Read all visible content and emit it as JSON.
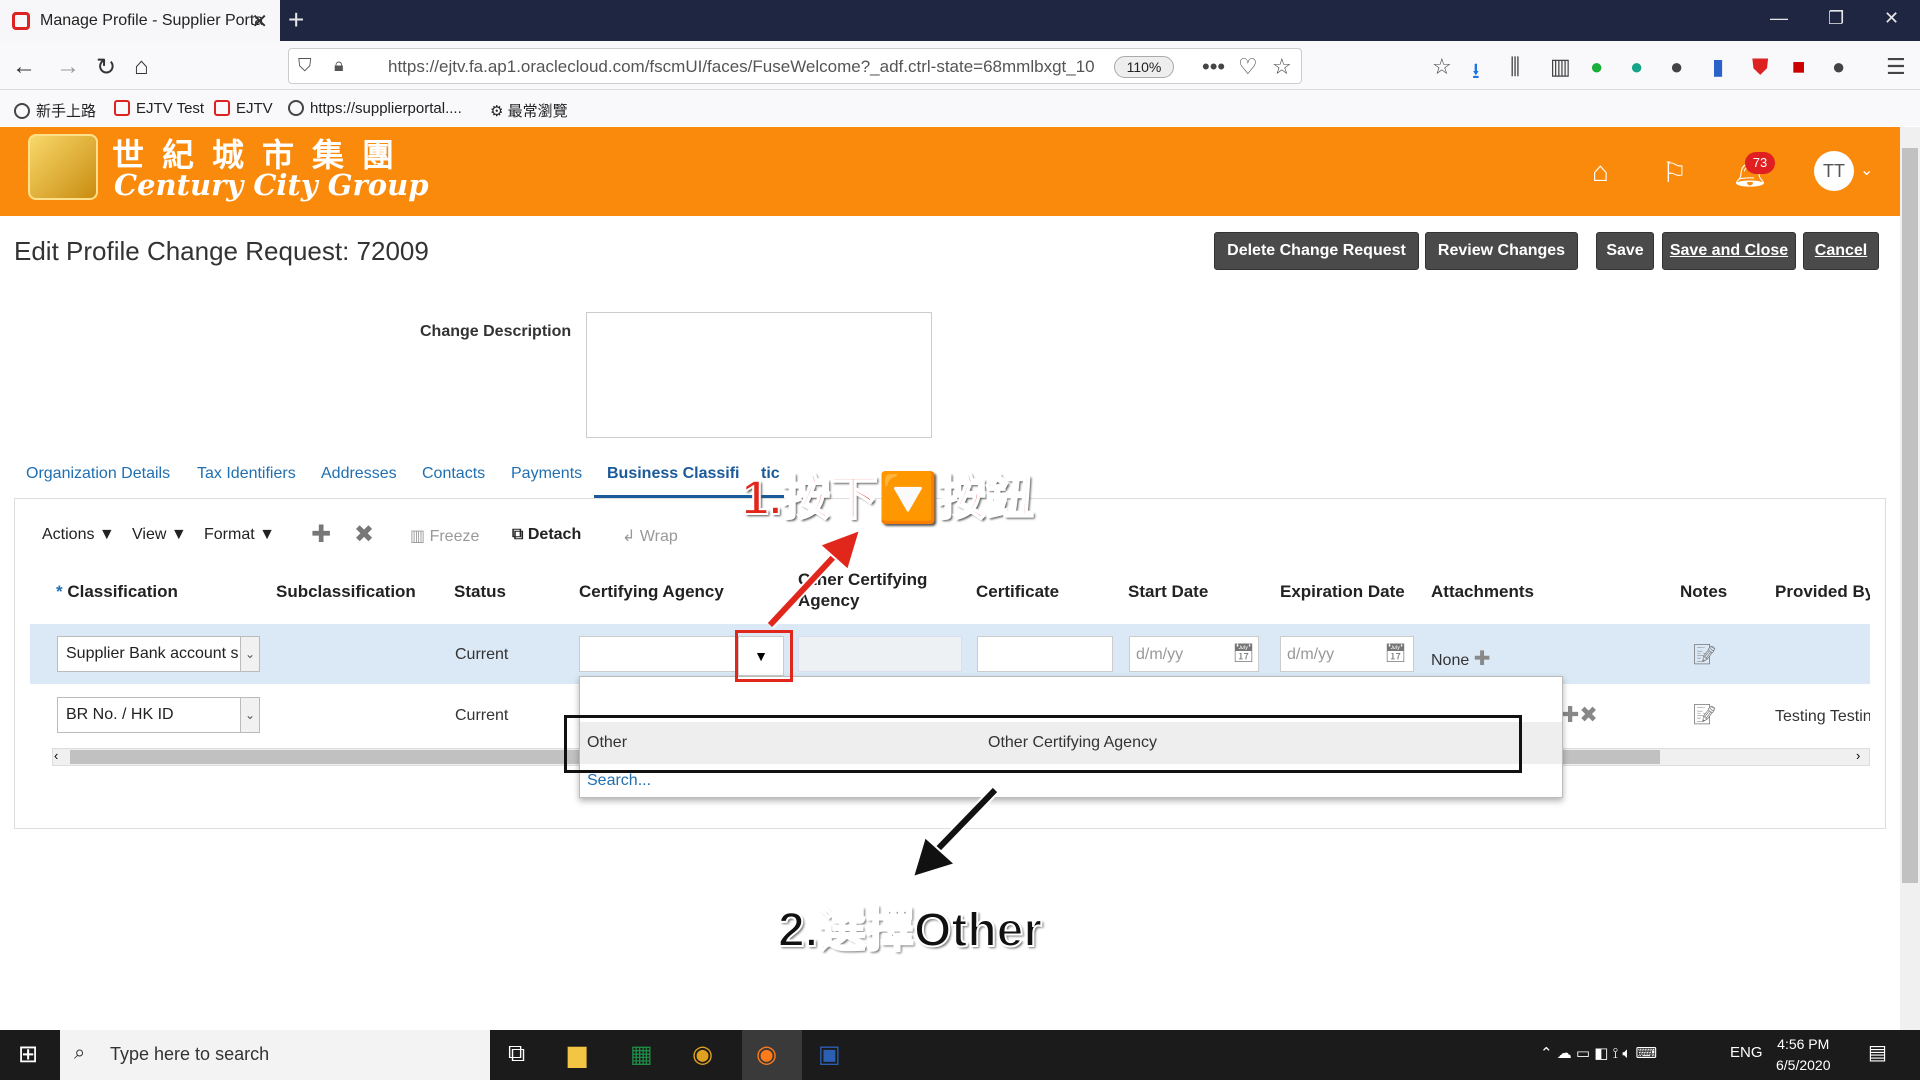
{
  "browser": {
    "tab_title": "Manage Profile - Supplier Porta",
    "url": "https://ejtv.fa.ap1.oraclecloud.com/fscmUI/faces/FuseWelcome?_adf.ctrl-state=68mmlbxgt_10",
    "zoom": "110%",
    "bookmarks": [
      "新手上路",
      "EJTV Test",
      "EJTV",
      "https://supplierportal....",
      "最常瀏覽"
    ]
  },
  "header": {
    "logo_cn": "世紀城市集團",
    "logo_en": "Century City Group",
    "notification_count": "73",
    "avatar_initials": "TT"
  },
  "page": {
    "title": "Edit Profile Change Request: 72009",
    "buttons": {
      "delete": "Delete Change Request",
      "review": "Review Changes",
      "save": "Save",
      "save_close": "Save and Close",
      "cancel": "Cancel"
    },
    "change_description_label": "Change Description",
    "tabs": [
      "Organization Details",
      "Tax Identifiers",
      "Addresses",
      "Contacts",
      "Payments",
      "Business Classifi",
      "tic"
    ],
    "toolbar": {
      "actions": "Actions",
      "view": "View",
      "format": "Format",
      "freeze": "Freeze",
      "detach": "Detach",
      "wrap": "Wrap"
    },
    "columns": [
      "Classification",
      "Subclassification",
      "Status",
      "Certifying Agency",
      "Other Certifying",
      "Agency",
      "Certificate",
      "Start Date",
      "Expiration Date",
      "Attachments",
      "Notes",
      "Provided By"
    ],
    "rows": [
      {
        "classification": "Supplier Bank account s",
        "status": "Current",
        "start_placeholder": "d/m/yy",
        "exp_placeholder": "d/m/yy",
        "attachments": "None"
      },
      {
        "classification": "BR No. / HK ID",
        "status": "Current",
        "provided_by": "Testing Testin"
      }
    ],
    "dropdown": {
      "option_code": "Other",
      "option_desc": "Other Certifying Agency",
      "search": "Search..."
    }
  },
  "annotations": {
    "step1": "1.按下🔽按鈕",
    "step2": "2.選擇Other"
  },
  "taskbar": {
    "search_placeholder": "Type here to search",
    "lang": "ENG",
    "time": "4:56 PM",
    "date": "6/5/2020"
  }
}
